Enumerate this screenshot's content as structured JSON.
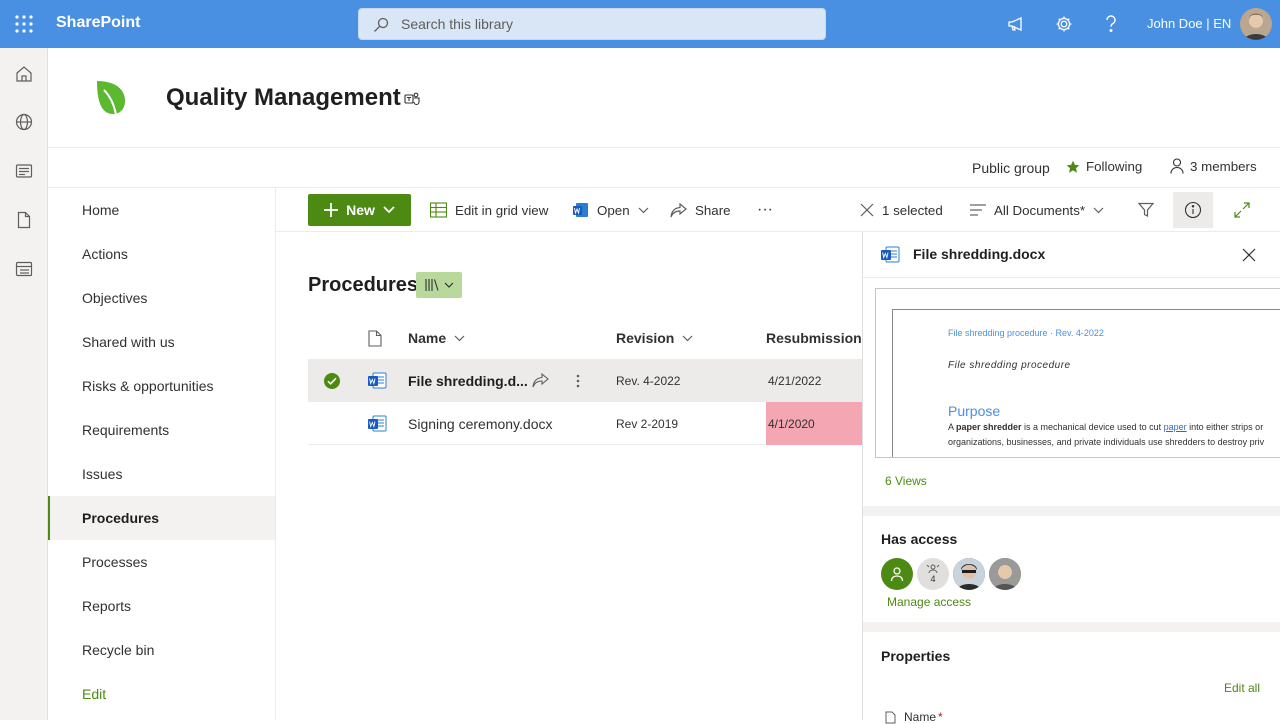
{
  "topbar": {
    "brand": "SharePoint",
    "search_placeholder": "Search this library",
    "user_label": "John Doe | EN"
  },
  "site": {
    "title": "Quality Management",
    "group_type": "Public group",
    "following_label": "Following",
    "members_label": "3 members"
  },
  "nav": {
    "items": [
      {
        "label": "Home"
      },
      {
        "label": "Actions"
      },
      {
        "label": "Objectives"
      },
      {
        "label": "Shared with us"
      },
      {
        "label": "Risks & opportunities"
      },
      {
        "label": "Requirements"
      },
      {
        "label": "Issues"
      },
      {
        "label": "Procedures",
        "active": true
      },
      {
        "label": "Processes"
      },
      {
        "label": "Reports"
      },
      {
        "label": "Recycle bin"
      }
    ],
    "edit_label": "Edit"
  },
  "commandbar": {
    "new_label": "New",
    "edit_grid_label": "Edit in grid view",
    "open_label": "Open",
    "share_label": "Share",
    "more_label": "···",
    "selected_label": "1 selected",
    "view_label": "All Documents*"
  },
  "library": {
    "title": "Procedures",
    "columns": {
      "name": "Name",
      "revision": "Revision",
      "resubmission": "Resubmission"
    },
    "rows": [
      {
        "name": "File shredding.d...",
        "revision": "Rev. 4-2022",
        "resubmission": "4/21/2022",
        "selected": true
      },
      {
        "name": "Signing ceremony.docx",
        "revision": "Rev 2-2019",
        "resubmission": "4/1/2020",
        "overdue": true
      }
    ]
  },
  "details": {
    "file_name": "File shredding.docx",
    "preview": {
      "header": "File shredding procedure · Rev. 4-2022",
      "doc_title": "File shredding procedure",
      "heading": "Purpose",
      "line1_a": "A ",
      "line1_b": "paper shredder",
      "line1_c": " is a mechanical device used to cut ",
      "line1_link": "paper",
      "line1_d": " into either strips or",
      "line2": "organizations, businesses, and private individuals  use shredders to destroy priv"
    },
    "views": "6 Views",
    "has_access_title": "Has access",
    "access_group_count": "4",
    "manage_access": "Manage access",
    "properties_title": "Properties",
    "edit_all": "Edit all",
    "first_property": "Name",
    "required_mark": "*"
  },
  "colors": {
    "suite_bar": "#4a90e2",
    "accent_green": "#4d8a13",
    "overdue_red": "#f4a7b3"
  }
}
